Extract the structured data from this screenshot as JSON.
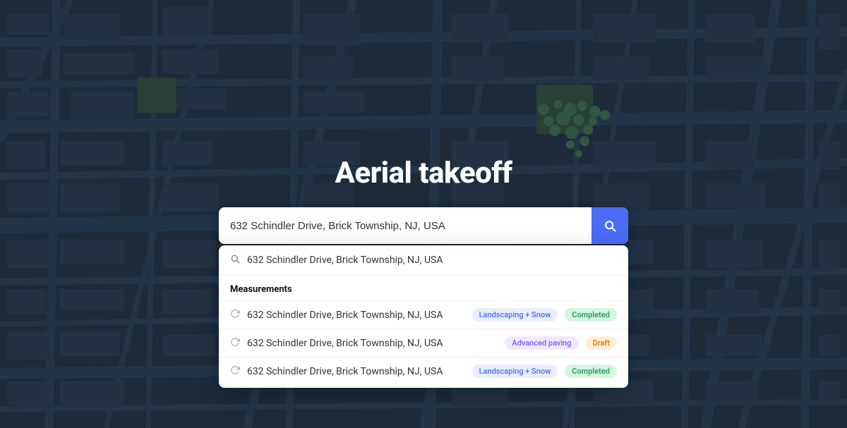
{
  "page": {
    "title": "Aerial takeoff"
  },
  "search": {
    "value": "632 Schindler Drive, Brick Township, NJ, USA",
    "placeholder": "632 Schindler Drive, Brick Township, NJ, USA",
    "button_label": "Search"
  },
  "dropdown": {
    "suggestion": {
      "text": "632 Schindler Drive, Brick Township, NJ, USA"
    },
    "measurements_label": "Measurements",
    "rows": [
      {
        "address": "632 Schindler Drive, Brick Township, NJ, USA",
        "tag": "Landscaping + Snow",
        "tag_type": "landscaping",
        "status": "Completed",
        "status_type": "completed"
      },
      {
        "address": "632 Schindler Drive, Brick Township, NJ, USA",
        "tag": "Advanced paving",
        "tag_type": "advanced",
        "status": "Draft",
        "status_type": "draft"
      },
      {
        "address": "632 Schindler Drive, Brick Township, NJ, USA",
        "tag": "Landscaping + Snow",
        "tag_type": "landscaping",
        "status": "Completed",
        "status_type": "completed"
      }
    ]
  },
  "colors": {
    "accent": "#4a6cf7",
    "bg_dark": "#1e2a3a"
  }
}
